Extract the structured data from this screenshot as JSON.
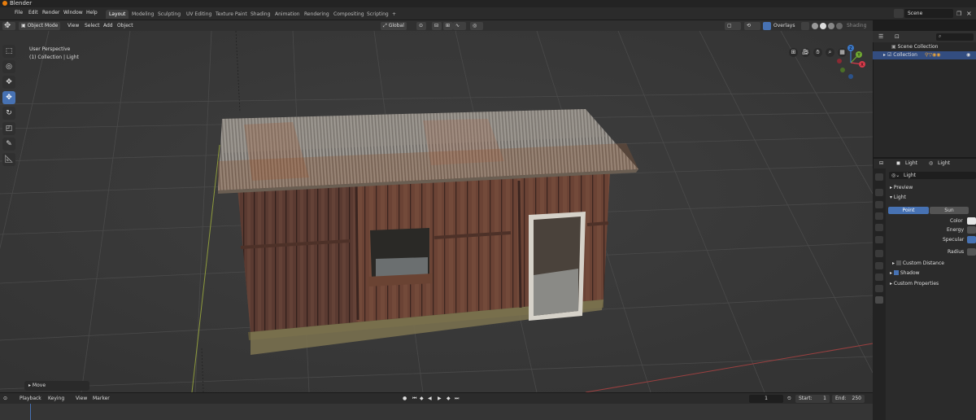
{
  "app": {
    "title": "Blender"
  },
  "menus": [
    "File",
    "Edit",
    "Render",
    "Window",
    "Help"
  ],
  "workspaces": [
    "Layout",
    "Modeling",
    "Sculpting",
    "UV Editing",
    "Texture Paint",
    "Shading",
    "Animation",
    "Rendering",
    "Compositing",
    "Scripting"
  ],
  "active_workspace": "Layout",
  "add_workspace_symbol": "+",
  "scene": "Scene",
  "viewport_header": {
    "mode": "Object Mode",
    "menus": [
      "View",
      "Select",
      "Add",
      "Object"
    ],
    "orientation": "Global",
    "overlays": "Overlays",
    "shading": "Shading"
  },
  "viewport_overlay": {
    "perspective": "User Perspective",
    "collection": "(1) Collection | Light"
  },
  "gizmo": {
    "x": "X",
    "y": "Y",
    "z": "Z",
    "colors": {
      "x": "#d63a4a",
      "y": "#6fa832",
      "z": "#3b78c8",
      "neg": "#8a2a33"
    }
  },
  "last_operator": "Move",
  "timeline": {
    "menus": [
      "Playback",
      "Keying",
      "View",
      "Marker"
    ],
    "current_frame": "1",
    "start_label": "Start:",
    "start": "1",
    "end_label": "End:",
    "end": "250"
  },
  "outliner": {
    "root": "Scene Collection",
    "collection": "Collection"
  },
  "properties": {
    "tab_object": "Light",
    "tab_data": "Light",
    "datablock": "Light",
    "panels": {
      "preview": "Preview",
      "light": "Light",
      "custom_distance": "Custom Distance",
      "shadow": "Shadow",
      "custom_properties": "Custom Properties"
    },
    "light_types": [
      "Point",
      "Sun"
    ],
    "active_light_type": "Point",
    "fields": {
      "color": "Color",
      "energy": "Energy",
      "specular": "Specular",
      "radius": "Radius"
    }
  },
  "colors": {
    "accent": "#4772b3",
    "origin_orange": "#e87d0d"
  }
}
